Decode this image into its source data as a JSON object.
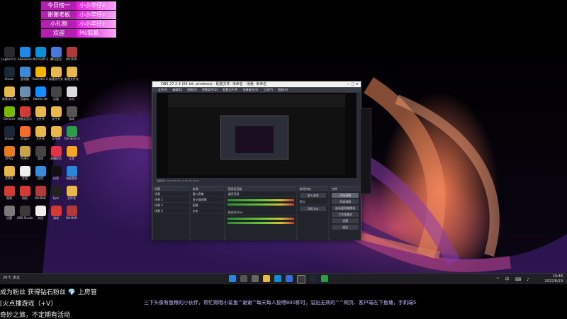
{
  "leaderboard": [
    {
      "rank": "今日榜一",
      "name": "小小华仔z"
    },
    {
      "rank": "谢谢老板",
      "name": "小小华仔z"
    },
    {
      "rank": "小礼物",
      "name": "小小华仔z"
    },
    {
      "rank": "欢迎",
      "name": "Ms狐狐"
    }
  ],
  "desktop_icons": [
    {
      "label": "Logitech G HUB",
      "color": "#2a2a2a"
    },
    {
      "label": "Alienware",
      "color": "#1e88e5"
    },
    {
      "label": "Microsoft Edge",
      "color": "#0c8fd6"
    },
    {
      "label": "腾讯会议",
      "color": "#4a7ad8"
    },
    {
      "label": "WinRAR",
      "color": "#b03a3a"
    },
    {
      "label": "Steam",
      "color": "#1b2838"
    },
    {
      "label": "此电脑",
      "color": "#3a8ad8"
    },
    {
      "label": "Rockstar Games",
      "color": "#f2b400"
    },
    {
      "label": "新建文件夹",
      "color": "#e8b84a"
    },
    {
      "label": "新建文件夹",
      "color": "#e8b84a"
    },
    {
      "label": "新建文件夹",
      "color": "#e8b84a"
    },
    {
      "label": "回收站",
      "color": "#6a8fb0"
    },
    {
      "label": "Battle.net",
      "color": "#148eff"
    },
    {
      "label": "设备",
      "color": "#444"
    },
    {
      "label": "文档",
      "color": "#ddd"
    },
    {
      "label": "GeForce",
      "color": "#76b900"
    },
    {
      "label": "网易云音乐",
      "color": "#d33a31"
    },
    {
      "label": "文件夹",
      "color": "#e8b84a"
    },
    {
      "label": "文件夹",
      "color": "#e8b84a"
    },
    {
      "label": "游戏",
      "color": "#555"
    },
    {
      "label": "Steam",
      "color": "#1b2838"
    },
    {
      "label": "Origin",
      "color": "#f56c2d"
    },
    {
      "label": "文件夹",
      "color": "#e8b84a"
    },
    {
      "label": "文件夹",
      "color": "#e8b84a"
    },
    {
      "label": "The Sims 4",
      "color": "#2e9d4a"
    },
    {
      "label": "UPlay",
      "color": "#e37b1f"
    },
    {
      "label": "PUBG",
      "color": "#c8a24a"
    },
    {
      "label": "游戏",
      "color": "#444"
    },
    {
      "label": "直播伴侣",
      "color": "#e0324a"
    },
    {
      "label": "斗鱼",
      "color": "#f5a623"
    },
    {
      "label": "文件夹",
      "color": "#e8b84a"
    },
    {
      "label": "文档",
      "color": "#eee"
    },
    {
      "label": "应用",
      "color": "#3a8ad8"
    },
    {
      "label": "抖音",
      "color": "#111"
    },
    {
      "label": "电脑管家",
      "color": "#2b88d8"
    },
    {
      "label": "视频",
      "color": "#d33a31"
    },
    {
      "label": "网易",
      "color": "#d33a31"
    },
    {
      "label": "WinRAR",
      "color": "#b03a3a"
    },
    {
      "label": "Epic",
      "color": "#222"
    },
    {
      "label": "文件夹",
      "color": "#e8b84a"
    },
    {
      "label": "设置",
      "color": "#7a7a7a"
    },
    {
      "label": "OBS Studio",
      "color": "#3a3a3a"
    },
    {
      "label": "文档",
      "color": "#eee"
    },
    {
      "label": "游戏",
      "color": "#d33a31"
    },
    {
      "label": "WinRAR",
      "color": "#b03a3a"
    }
  ],
  "obs": {
    "title": "OBS 27.2.4 (64 bit, windows) - 配置文件: 未命名 - 场景: 未命名",
    "menu": [
      "文件(F)",
      "编辑(E)",
      "视图(V)",
      "停靠部件(D)",
      "配置文件(P)",
      "场景集合(S)",
      "工具(T)",
      "帮助(H)"
    ],
    "status": "直播时间: 00:00:00  CPU: 2.1%, 60.00 fps",
    "scenes_header": "场景",
    "scenes": [
      "场景",
      "场景 2",
      "场景 3",
      "场景 4"
    ],
    "sources_header": "来源",
    "sources": [
      "窗口采集",
      "显示器采集",
      "图像",
      "文本"
    ],
    "mixer_header": "音频混音器",
    "mixer_tracks": [
      "桌面音频",
      "麦克风/Aux"
    ],
    "transitions_header": "转场特效",
    "transition_value": "淡入淡出",
    "duration_label": "时长",
    "duration_value": "300 ms",
    "controls_header": "控件",
    "controls": [
      "开始直播",
      "开始录制",
      "启动虚拟摄像机",
      "工作室模式",
      "设置",
      "退出"
    ]
  },
  "taskbar": {
    "weather": "26°C 多云",
    "clock_time": "19:48",
    "clock_date": "2022/8/19",
    "tray": "^ 中 ⌨ ♪"
  },
  "bottom_overlay": {
    "line1": "成为粉丝 获得钻石粉丝 💎 上房管",
    "line2": "[火点播游戏（+V）",
    "line3": "奇妙之旅，不定期有活动",
    "marquee": "三下头像有鱼粮的小伙伴，帮忙赐哦小鲨鱼^谢谢^每天每人投喂800即可，溢出无效的^^网页、客户端左下鱼塘，手机端5"
  },
  "colors": {
    "leaderboard_rank_bg": "#b31fb0",
    "leaderboard_name_bg": "#e31ee0",
    "marquee_text": "#c9b8ff"
  }
}
